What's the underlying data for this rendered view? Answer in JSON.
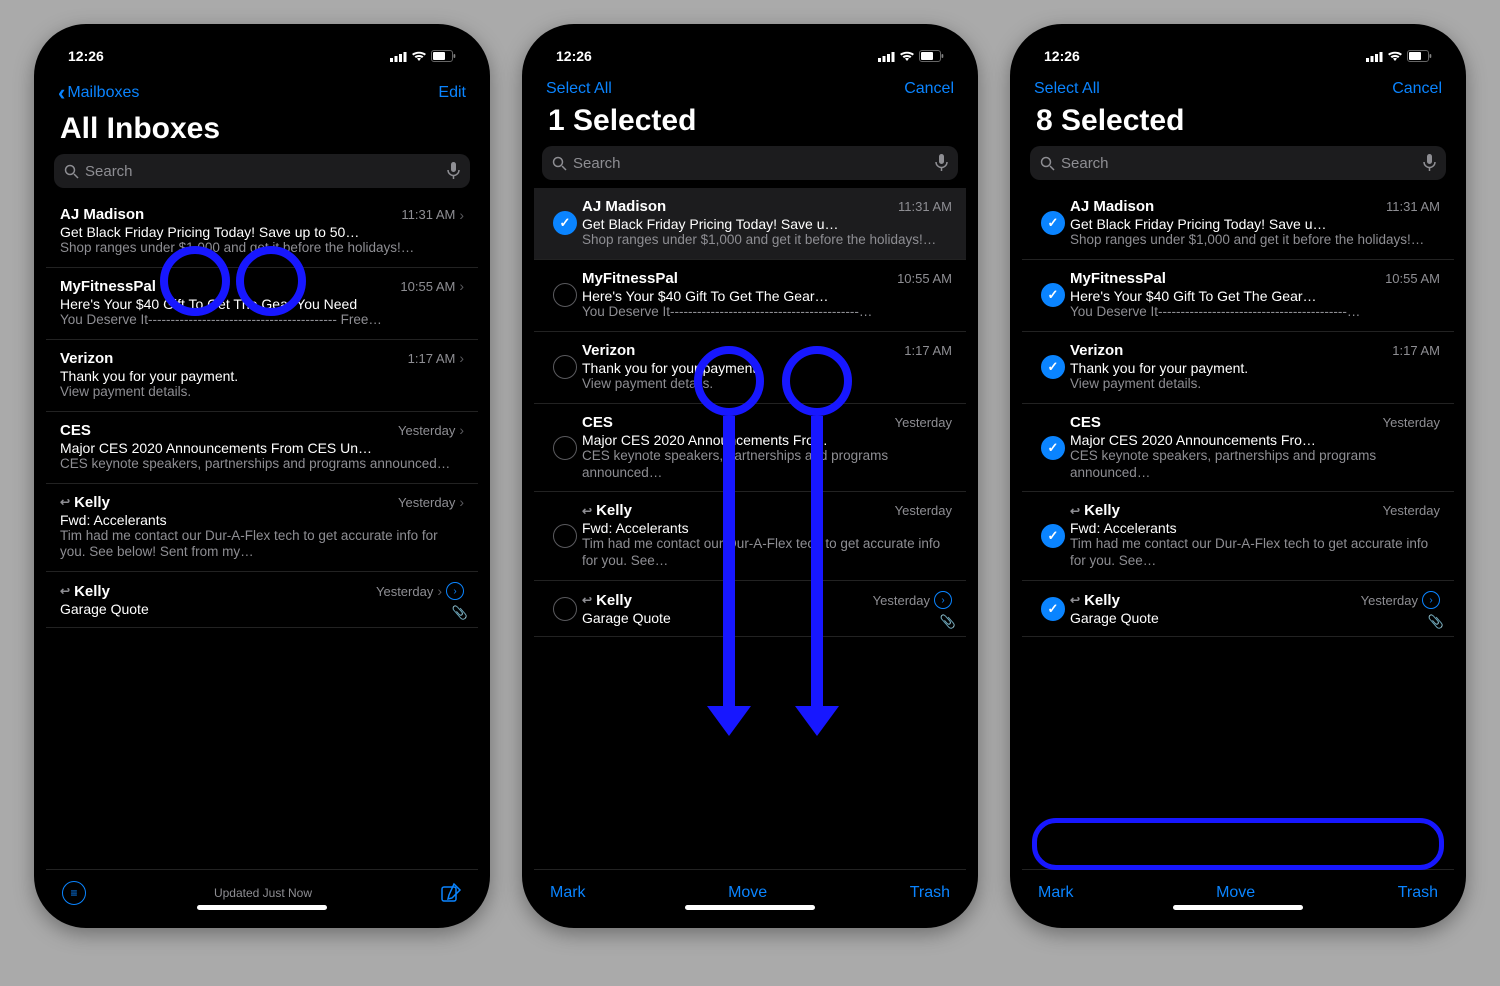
{
  "status_time": "12:26",
  "search_placeholder": "Search",
  "screens": [
    {
      "nav_left": "Mailboxes",
      "nav_back": true,
      "nav_right": "Edit",
      "title": "All Inboxes",
      "edit_mode": false,
      "toolbar_mode": "status",
      "status_text": "Updated Just Now",
      "overlay": "tap",
      "emails": [
        {
          "sender": "AJ Madison",
          "time": "11:31 AM",
          "subject": "Get Black Friday Pricing Today! Save up to 50…",
          "preview": "Shop ranges under $1,000 and get it before the holidays!…"
        },
        {
          "sender": "MyFitnessPal",
          "time": "10:55 AM",
          "subject": "Here's Your $40 Gift To Get The Gear You Need",
          "preview": "You Deserve It------------------------------------------ Free…"
        },
        {
          "sender": "Verizon",
          "time": "1:17 AM",
          "subject": "Thank you for your payment.",
          "preview": "View payment details."
        },
        {
          "sender": "CES",
          "time": "Yesterday",
          "subject": "Major CES 2020 Announcements From CES Un…",
          "preview": "CES keynote speakers, partnerships and programs announced…"
        },
        {
          "sender": "Kelly",
          "time": "Yesterday",
          "subject": "Fwd: Accelerants",
          "preview": "Tim had me contact our Dur-A-Flex tech to get accurate info for you. See below! Sent from my…",
          "reply": true
        },
        {
          "sender": "Kelly",
          "time": "Yesterday",
          "subject": "Garage Quote",
          "preview": "",
          "reply": true,
          "thread": true,
          "attach": true,
          "truncated": true
        }
      ]
    },
    {
      "nav_left": "Select All",
      "nav_back": false,
      "nav_right": "Cancel",
      "title": "1 Selected",
      "edit_mode": true,
      "toolbar_mode": "edit",
      "btn_mark": "Mark",
      "btn_move": "Move",
      "btn_trash": "Trash",
      "overlay": "swipe",
      "emails": [
        {
          "sel": true,
          "sender": "AJ Madison",
          "time": "11:31 AM",
          "subject": "Get Black Friday Pricing Today! Save u…",
          "preview": "Shop ranges under $1,000 and get it before the holidays!…"
        },
        {
          "sel": false,
          "sender": "MyFitnessPal",
          "time": "10:55 AM",
          "subject": "Here's Your $40 Gift To Get The Gear…",
          "preview": "You Deserve It------------------------------------------…"
        },
        {
          "sel": false,
          "sender": "Verizon",
          "time": "1:17 AM",
          "subject": "Thank you for your payment.",
          "preview": "View payment details."
        },
        {
          "sel": false,
          "sender": "CES",
          "time": "Yesterday",
          "subject": "Major CES 2020 Announcements Fro…",
          "preview": "CES keynote speakers, partnerships and programs announced…"
        },
        {
          "sel": false,
          "sender": "Kelly",
          "time": "Yesterday",
          "subject": "Fwd: Accelerants",
          "preview": "Tim had me contact our Dur-A-Flex tech to get accurate info for you. See…",
          "reply": true
        },
        {
          "sel": false,
          "sender": "Kelly",
          "time": "Yesterday",
          "subject": "Garage Quote",
          "preview": "",
          "reply": true,
          "thread": true,
          "attach": true,
          "truncated": true
        }
      ]
    },
    {
      "nav_left": "Select All",
      "nav_back": false,
      "nav_right": "Cancel",
      "title": "8 Selected",
      "edit_mode": true,
      "toolbar_mode": "edit",
      "btn_mark": "Mark",
      "btn_move": "Move",
      "btn_trash": "Trash",
      "overlay": "toolbar",
      "emails": [
        {
          "sel": true,
          "sender": "AJ Madison",
          "time": "11:31 AM",
          "subject": "Get Black Friday Pricing Today! Save u…",
          "preview": "Shop ranges under $1,000 and get it before the holidays!…"
        },
        {
          "sel": true,
          "sender": "MyFitnessPal",
          "time": "10:55 AM",
          "subject": "Here's Your $40 Gift To Get The Gear…",
          "preview": "You Deserve It------------------------------------------…"
        },
        {
          "sel": true,
          "sender": "Verizon",
          "time": "1:17 AM",
          "subject": "Thank you for your payment.",
          "preview": "View payment details."
        },
        {
          "sel": true,
          "sender": "CES",
          "time": "Yesterday",
          "subject": "Major CES 2020 Announcements Fro…",
          "preview": "CES keynote speakers, partnerships and programs announced…"
        },
        {
          "sel": true,
          "sender": "Kelly",
          "time": "Yesterday",
          "subject": "Fwd: Accelerants",
          "preview": "Tim had me contact our Dur-A-Flex tech to get accurate info for you. See…",
          "reply": true
        },
        {
          "sel": true,
          "sender": "Kelly",
          "time": "Yesterday",
          "subject": "Garage Quote",
          "preview": "",
          "reply": true,
          "thread": true,
          "attach": true,
          "truncated": true
        }
      ]
    }
  ]
}
